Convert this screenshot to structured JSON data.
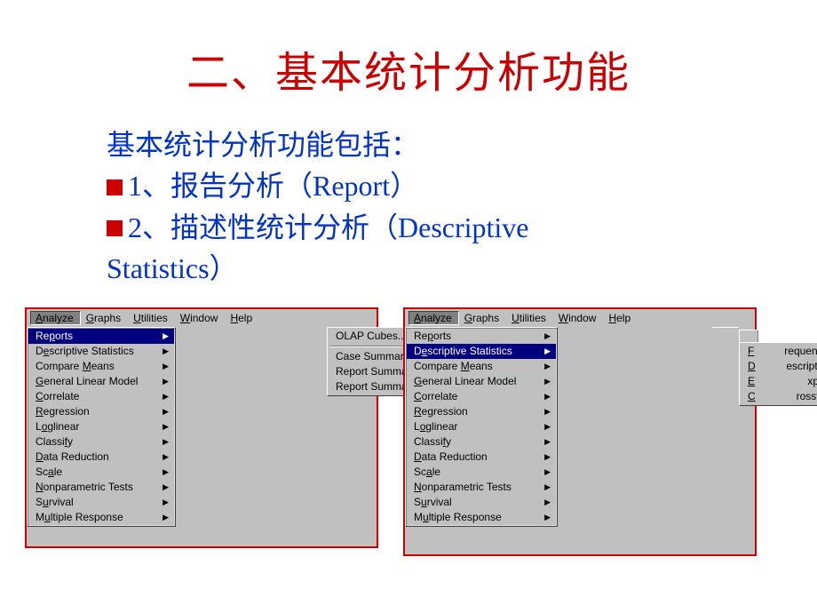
{
  "title": "二、基本统计分析功能",
  "body": {
    "line1": "基本统计分析功能包括：",
    "line2": "1、报告分析（Report）",
    "line3": "2、描述性统计分析（Descriptive",
    "line4": "Statistics）"
  },
  "menubar": {
    "analyze": {
      "u": "A",
      "rest": "nalyze"
    },
    "graphs": {
      "u": "G",
      "rest": "raphs"
    },
    "utilities": {
      "u": "U",
      "rest": "tilities"
    },
    "window": {
      "u": "W",
      "rest": "indow"
    },
    "help": {
      "u": "H",
      "rest": "elp"
    }
  },
  "analyze_menu": [
    {
      "u": "",
      "pre": "Re",
      "ul": "p",
      "post": "orts",
      "arrow": true,
      "highlight_left": true
    },
    {
      "u": "",
      "pre": "D",
      "ul": "e",
      "post": "scriptive Statistics",
      "arrow": true,
      "highlight_right": true
    },
    {
      "u": "",
      "pre": "Compare ",
      "ul": "M",
      "post": "eans",
      "arrow": true
    },
    {
      "u": "",
      "pre": "",
      "ul": "G",
      "post": "eneral Linear Model",
      "arrow": true
    },
    {
      "u": "",
      "pre": "",
      "ul": "C",
      "post": "orrelate",
      "arrow": true
    },
    {
      "u": "",
      "pre": "",
      "ul": "R",
      "post": "egression",
      "arrow": true
    },
    {
      "u": "",
      "pre": "L",
      "ul": "o",
      "post": "glinear",
      "arrow": true
    },
    {
      "u": "",
      "pre": "Classi",
      "ul": "f",
      "post": "y",
      "arrow": true
    },
    {
      "u": "",
      "pre": "",
      "ul": "D",
      "post": "ata Reduction",
      "arrow": true
    },
    {
      "u": "",
      "pre": "Sc",
      "ul": "a",
      "post": "le",
      "arrow": true
    },
    {
      "u": "",
      "pre": "",
      "ul": "N",
      "post": "onparametric Tests",
      "arrow": true
    },
    {
      "u": "",
      "pre": "S",
      "ul": "u",
      "post": "rvival",
      "arrow": true
    },
    {
      "u": "",
      "pre": "M",
      "ul": "u",
      "post": "ltiple Response",
      "arrow": true
    }
  ],
  "reports_submenu": [
    {
      "label": "OLAP Cubes..."
    },
    {
      "sep": true
    },
    {
      "label": "Case Summaries..."
    },
    {
      "label": "Report Summaries in Rows..."
    },
    {
      "label": "Report Summaries in Columns..."
    }
  ],
  "descriptives_submenu": [
    {
      "pre": "",
      "ul": "F",
      "post": "requencies..."
    },
    {
      "pre": "",
      "ul": "D",
      "post": "escriptives..."
    },
    {
      "pre": "",
      "ul": "E",
      "post": "xplore..."
    },
    {
      "pre": "",
      "ul": "C",
      "post": "rosstabs..."
    }
  ]
}
